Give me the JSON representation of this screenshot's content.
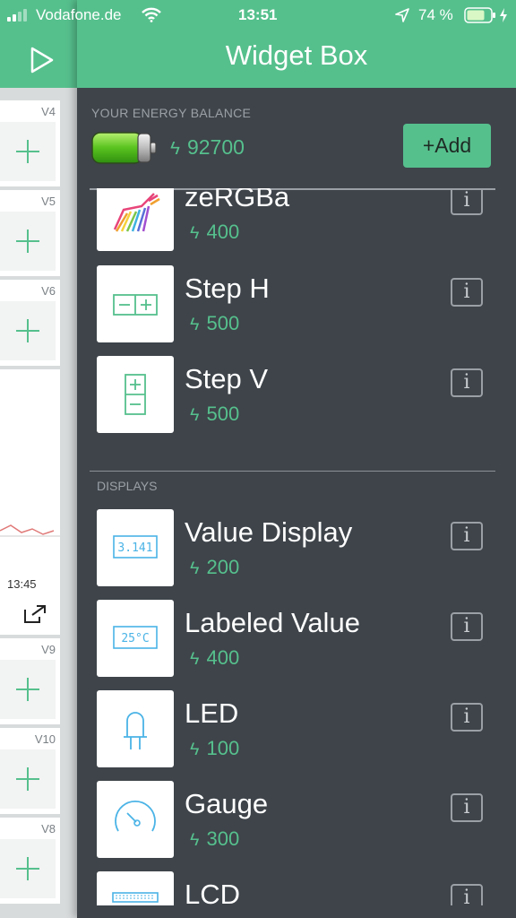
{
  "status_bar": {
    "carrier": "Vodafone.de",
    "time": "13:51",
    "battery_percent": "74 %"
  },
  "background": {
    "cards": [
      {
        "label": "V4"
      },
      {
        "label": "V5"
      },
      {
        "label": "V6"
      },
      {
        "label": "V9"
      },
      {
        "label": "V10"
      },
      {
        "label": "V8"
      }
    ],
    "chart_time": "13:45"
  },
  "drawer": {
    "title": "Widget Box",
    "balance_label": "YOUR ENERGY BALANCE",
    "balance_value": "92700",
    "add_label": "+Add",
    "bolt": "ϟ",
    "info_label": "i",
    "section_displays": "DISPLAYS",
    "items": [
      {
        "name": "zeRGBa",
        "cost": "400",
        "icon": "zergba-icon"
      },
      {
        "name": "Step H",
        "cost": "500",
        "icon": "step-h-icon"
      },
      {
        "name": "Step V",
        "cost": "500",
        "icon": "step-v-icon"
      },
      {
        "name": "Value Display",
        "cost": "200",
        "icon": "value-display-icon",
        "icon_text": "3.141"
      },
      {
        "name": "Labeled Value",
        "cost": "400",
        "icon": "labeled-value-icon",
        "icon_text": "25°C"
      },
      {
        "name": "LED",
        "cost": "100",
        "icon": "led-icon"
      },
      {
        "name": "Gauge",
        "cost": "300",
        "icon": "gauge-icon"
      },
      {
        "name": "LCD",
        "cost": "",
        "icon": "lcd-icon"
      }
    ]
  },
  "colors": {
    "accent": "#56c08d",
    "drawer_bg": "#3e444a",
    "display_icon": "#4ab3e6"
  }
}
